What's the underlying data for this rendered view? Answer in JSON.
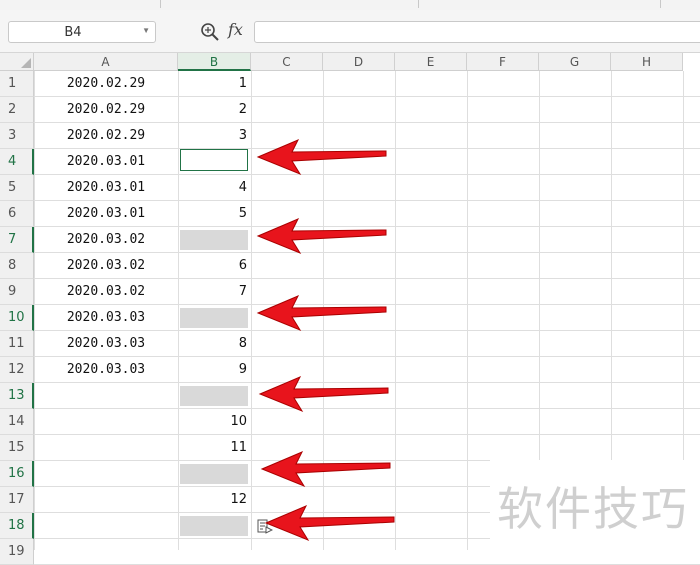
{
  "formula_bar": {
    "name_box": "B4",
    "fx_label": "fx",
    "formula_value": ""
  },
  "columns": [
    "A",
    "B",
    "C",
    "D",
    "E",
    "F",
    "G",
    "H"
  ],
  "active_column": "B",
  "rows": [
    {
      "num": "1",
      "a": "2020.02.29",
      "b": "1",
      "blank": false,
      "highlight": false
    },
    {
      "num": "2",
      "a": "2020.02.29",
      "b": "2",
      "blank": false,
      "highlight": false
    },
    {
      "num": "3",
      "a": "2020.02.29",
      "b": "3",
      "blank": false,
      "highlight": false
    },
    {
      "num": "4",
      "a": "2020.03.01",
      "b": "",
      "blank": false,
      "highlight": true
    },
    {
      "num": "5",
      "a": "2020.03.01",
      "b": "4",
      "blank": false,
      "highlight": false
    },
    {
      "num": "6",
      "a": "2020.03.01",
      "b": "5",
      "blank": false,
      "highlight": false
    },
    {
      "num": "7",
      "a": "2020.03.02",
      "b": "",
      "blank": true,
      "highlight": true
    },
    {
      "num": "8",
      "a": "2020.03.02",
      "b": "6",
      "blank": false,
      "highlight": false
    },
    {
      "num": "9",
      "a": "2020.03.02",
      "b": "7",
      "blank": false,
      "highlight": false
    },
    {
      "num": "10",
      "a": "2020.03.03",
      "b": "",
      "blank": true,
      "highlight": true
    },
    {
      "num": "11",
      "a": "2020.03.03",
      "b": "8",
      "blank": false,
      "highlight": false
    },
    {
      "num": "12",
      "a": "2020.03.03",
      "b": "9",
      "blank": false,
      "highlight": false
    },
    {
      "num": "13",
      "a": "",
      "b": "",
      "blank": true,
      "highlight": true
    },
    {
      "num": "14",
      "a": "",
      "b": "10",
      "blank": false,
      "highlight": false
    },
    {
      "num": "15",
      "a": "",
      "b": "11",
      "blank": false,
      "highlight": false
    },
    {
      "num": "16",
      "a": "",
      "b": "",
      "blank": true,
      "highlight": true
    },
    {
      "num": "17",
      "a": "",
      "b": "12",
      "blank": false,
      "highlight": false
    },
    {
      "num": "18",
      "a": "",
      "b": "",
      "blank": true,
      "highlight": true
    },
    {
      "num": "19",
      "a": "",
      "b": "",
      "blank": false,
      "highlight": false
    }
  ],
  "watermark": "软件技巧",
  "colors": {
    "accent": "#217346",
    "arrow": "#e8141c",
    "blank_fill": "#d9d9d9"
  },
  "icons": [
    "zoom-formula-icon",
    "chevron-down-icon",
    "select-all-icon",
    "paste-options-icon",
    "red-arrow-icon"
  ]
}
